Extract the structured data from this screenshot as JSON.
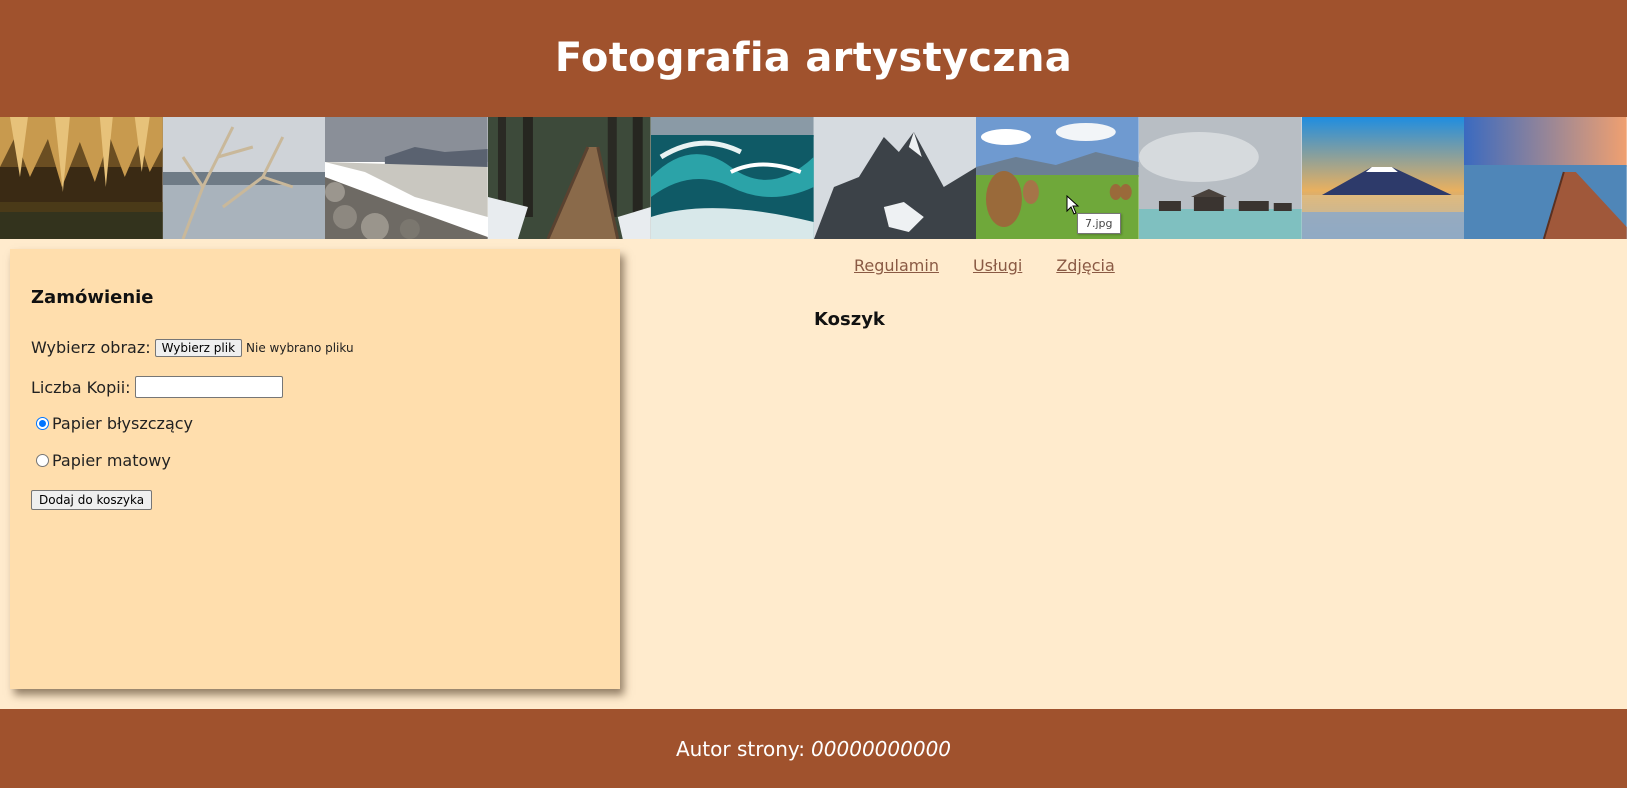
{
  "header": {
    "title": "Fotografia artystyczna"
  },
  "gallery": {
    "tooltip": "7.jpg",
    "images": [
      {
        "name": "cave"
      },
      {
        "name": "lake-branches"
      },
      {
        "name": "rocky-beach"
      },
      {
        "name": "forest-boardwalk"
      },
      {
        "name": "sea-waves"
      },
      {
        "name": "mountain-peak"
      },
      {
        "name": "haystacks-meadow"
      },
      {
        "name": "water-huts"
      },
      {
        "name": "volcano-lake"
      },
      {
        "name": "pier-sunset"
      }
    ]
  },
  "order": {
    "heading": "Zamówienie",
    "file_label": "Wybierz obraz:",
    "file_button": "Wybierz plik",
    "file_status": "Nie wybrano pliku",
    "copies_label": "Liczba Kopii:",
    "copies_value": "",
    "glossy_label": "Papier błyszczący",
    "matte_label": "Papier matowy",
    "add_button": "Dodaj do koszyka"
  },
  "nav": {
    "links": [
      "Regulamin",
      "Usługi",
      "Zdjęcia"
    ]
  },
  "cart": {
    "heading": "Koszyk"
  },
  "footer": {
    "prefix": "Autor strony:",
    "author": "00000000000"
  },
  "colors": {
    "header_bg": "#a0522d",
    "content_bg": "#ffebcd",
    "panel_bg": "#ffdead",
    "link": "#8a5a44"
  }
}
